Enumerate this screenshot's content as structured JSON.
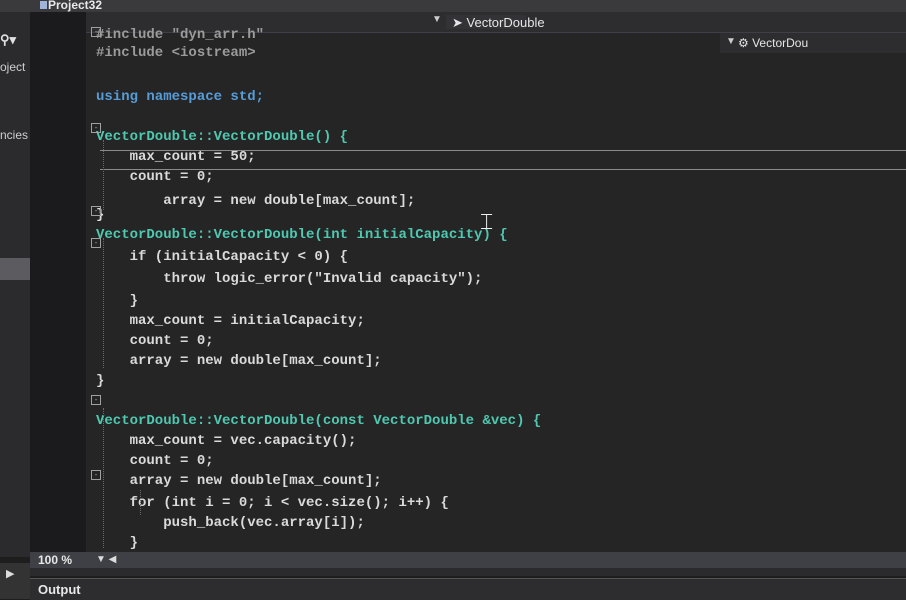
{
  "window": {
    "project_title": "Project32"
  },
  "left_panel": {
    "items": [
      "oject",
      "ncies"
    ]
  },
  "nav": {
    "member_dropdown": "VectorDouble",
    "member_dropdown_2": "VectorDou"
  },
  "code_lines": [
    {
      "segments": [
        {
          "t": "#include \"dyn_arr.h\"",
          "c": "str-inc"
        }
      ]
    },
    {
      "segments": [
        {
          "t": "#include <iostream>",
          "c": "str-inc"
        }
      ]
    },
    {
      "segments": []
    },
    {
      "segments": [
        {
          "t": "using namespace std;",
          "c": "kw"
        }
      ]
    },
    {
      "segments": []
    },
    {
      "segments": [
        {
          "t": "VectorDouble::VectorDouble() {",
          "c": "ty"
        }
      ]
    },
    {
      "segments": [
        {
          "t": "    max_count = 50;",
          "c": "mb"
        }
      ]
    },
    {
      "segments": [
        {
          "t": "    count = 0;",
          "c": "mb"
        }
      ]
    },
    {
      "segments": [
        {
          "t": "        array = new double[max_count];",
          "c": "mb"
        }
      ]
    },
    {
      "segments": [
        {
          "t": "}",
          "c": "mb"
        }
      ]
    },
    {
      "segments": [
        {
          "t": "VectorDouble::VectorDouble(int initialCapacity) {",
          "c": "ty"
        }
      ]
    },
    {
      "segments": [
        {
          "t": "    if (initialCapacity < 0) {",
          "c": "mb"
        }
      ]
    },
    {
      "segments": [
        {
          "t": "        throw logic_error(\"Invalid capacity\");",
          "c": "mb"
        }
      ]
    },
    {
      "segments": [
        {
          "t": "    }",
          "c": "mb"
        }
      ]
    },
    {
      "segments": [
        {
          "t": "    max_count = initialCapacity;",
          "c": "mb"
        }
      ]
    },
    {
      "segments": [
        {
          "t": "    count = 0;",
          "c": "mb"
        }
      ]
    },
    {
      "segments": [
        {
          "t": "    array = new double[max_count];",
          "c": "mb"
        }
      ]
    },
    {
      "segments": []
    },
    {
      "segments": [
        {
          "t": "}",
          "c": "mb"
        }
      ]
    },
    {
      "segments": []
    },
    {
      "segments": [
        {
          "t": "VectorDouble::VectorDouble(const VectorDouble &vec) {",
          "c": "ty"
        }
      ]
    },
    {
      "segments": [
        {
          "t": "    max_count = vec.capacity();",
          "c": "mb"
        }
      ]
    },
    {
      "segments": [
        {
          "t": "    count = 0;",
          "c": "mb"
        }
      ]
    },
    {
      "segments": [
        {
          "t": "    array = new double[max_count];",
          "c": "mb"
        }
      ]
    },
    {
      "segments": [
        {
          "t": "    for (int i = 0; i < vec.size(); i++) {",
          "c": "mb"
        }
      ]
    },
    {
      "segments": [
        {
          "t": "        push_back(vec.array[i]);",
          "c": "mb"
        }
      ]
    },
    {
      "segments": [
        {
          "t": "    }",
          "c": "mb"
        }
      ]
    },
    {
      "segments": [
        {
          "t": "}",
          "c": "mb"
        }
      ]
    }
  ],
  "status": {
    "zoom": "100 %"
  },
  "output_panel": {
    "label": "Output"
  },
  "colors": {
    "editor_bg": "#252526",
    "keyword": "#569cd6",
    "type": "#4ec9b0",
    "string": "#d69d85",
    "text": "#dcdcdc"
  }
}
